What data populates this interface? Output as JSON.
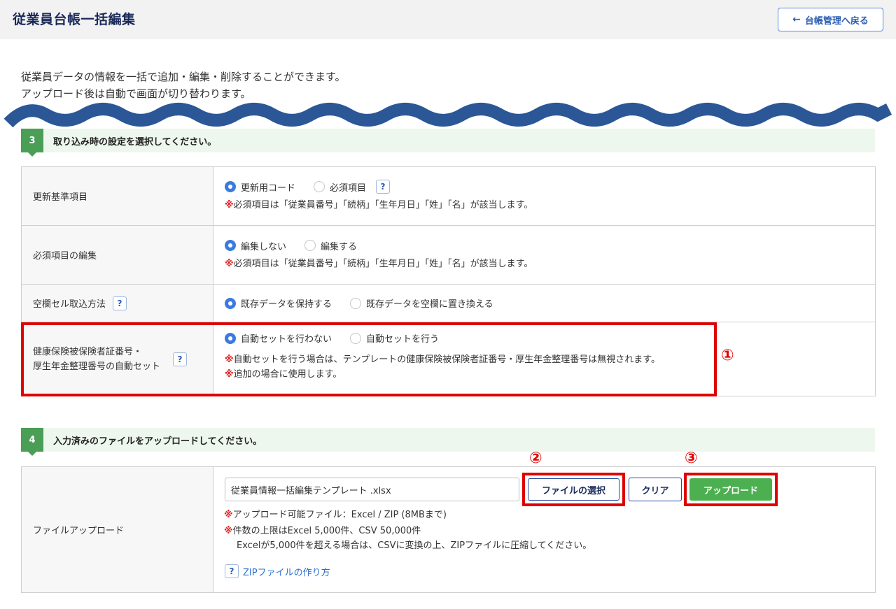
{
  "header": {
    "title": "従業員台帳一括編集",
    "back_label": "台帳管理へ戻る"
  },
  "intro": {
    "line1": "従業員データの情報を一括で追加・編集・削除することができます。",
    "line2": "アップロード後は自動で画面が切り替わります。"
  },
  "section3": {
    "number": "3",
    "title": "取り込み時の設定を選択してください。",
    "rows": [
      {
        "label": "更新基準項目",
        "options": [
          "更新用コード",
          "必須項目"
        ],
        "selected": 0,
        "note": "必須項目は「従業員番号」「続柄」「生年月日」「姓」「名」が該当します。"
      },
      {
        "label": "必須項目の編集",
        "options": [
          "編集しない",
          "編集する"
        ],
        "selected": 0,
        "note": "必須項目は「従業員番号」「続柄」「生年月日」「姓」「名」が該当します。"
      },
      {
        "label": "空欄セル取込方法",
        "options": [
          "既存データを保持する",
          "既存データを空欄に置き換える"
        ],
        "selected": 0
      },
      {
        "label_line1": "健康保険被保険者証番号・",
        "label_line2": "厚生年金整理番号の自動セット",
        "options": [
          "自動セットを行わない",
          "自動セットを行う"
        ],
        "selected": 0,
        "note1": "自動セットを行う場合は、テンプレートの健康保険被保険者証番号・厚生年金整理番号は無視されます。",
        "note2": "追加の場合に使用します。"
      }
    ]
  },
  "section4": {
    "number": "4",
    "title": "入力済みのファイルをアップロードしてください。",
    "label": "ファイルアップロード",
    "file_value": "従業員情報一括編集テンプレート .xlsx",
    "select_label": "ファイルの選択",
    "clear_label": "クリア",
    "upload_label": "アップロード",
    "note1": "アップロード可能ファイル：Excel / ZIP (8MBまで)",
    "note2": "件数の上限はExcel 5,000件、CSV 50,000件",
    "note3": "Excelが5,000件を超える場合は、CSVに変換の上、ZIPファイルに圧縮してください。",
    "zip_link": "ZIPファイルの作り方"
  },
  "markers": {
    "m1": "①",
    "m2": "②",
    "m3": "③",
    "note_mark": "※",
    "help": "?"
  },
  "colors": {
    "accent_red": "#e00000",
    "section_green": "#4a9e56",
    "wave_blue": "#2b5797",
    "upload_green": "#4caf50",
    "title_navy": "#1a2a5a"
  }
}
